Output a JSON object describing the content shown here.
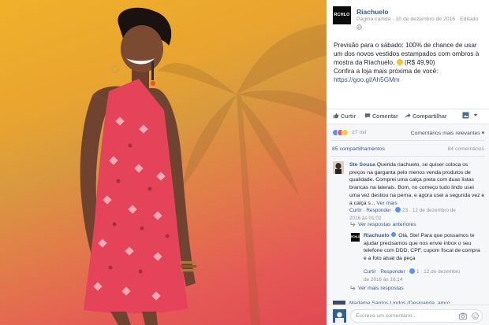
{
  "post": {
    "page_name": "Riachuelo",
    "avatar_text": "RCHLO",
    "meta_page": "Página curtida",
    "meta_sep": "·",
    "meta_date": "10 de dezembro de 2016",
    "meta_edit_sep": "·",
    "meta_edited": "Editado",
    "caption_lines": [
      "Previsão para o sábado: 100% de chance de usar",
      "um dos novos vestidos estampados com ombros à",
      "mostra da Riachuelo.",
      "(R$ 49,90)",
      "Confira a loja mais próxima de você:",
      "https://goo.gl/Ah5GMm"
    ]
  },
  "actions": {
    "like": "Curtir",
    "comment": "Comentar",
    "share": "Compartilhar"
  },
  "reactions": {
    "count": "27 mil",
    "sort_label": "Comentários mais relevantes",
    "shares": "85 compartilhamentos",
    "comments": "84 comentários"
  },
  "comment1": {
    "author": "Ste Sousa",
    "text": "Querida riachuelo, se quiser coloca os preços na garganta pelo menos venda produtos de qualidade. Comprei uma calça preta com duas listas brancas na laterais. Bom, no começo tudo lindo usei uma vez destiou na perna, e agora usei a segunda vez e a calça s...",
    "see_more": "Ver mais",
    "like": "Curtir",
    "reply": "Responder",
    "likes": "23",
    "date_line1": "12 de dezembro de",
    "date_line2": "2016 às 01:02"
  },
  "previous_replies": "Ver respostas anteriores",
  "reply1": {
    "avatar_text": "RCHLO",
    "author": "Riachuelo",
    "text": "Olá, Ste! Para que possamos te ajudar precisamos que nos envie inbox o seu telefone com DDD, CPF, cupom fiscal de compra e a foto atual da peça",
    "like": "Curtir",
    "reply": "Responder",
    "likes": "1",
    "date_line1": "12 de dezembro",
    "date_line2": "de 2016 às 16:14"
  },
  "more_replies": "Ver mais respostas",
  "comment2_peek": "Madame Santos  Lindos (Desiganda, amo)",
  "composer": {
    "placeholder": "Escreva um comentário..."
  }
}
